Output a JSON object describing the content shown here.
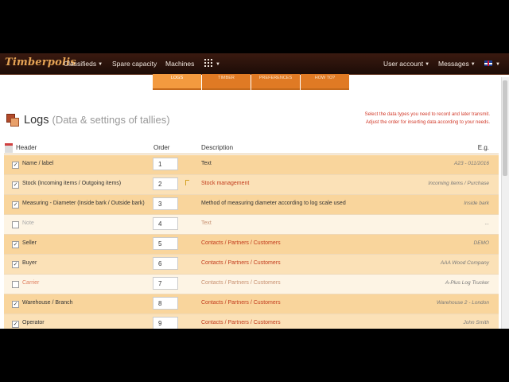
{
  "navbar": {
    "brand": "Timberpolis",
    "items": [
      {
        "label": "Classifieds",
        "caret": "▼"
      },
      {
        "label": "Spare capacity",
        "caret": ""
      },
      {
        "label": "Machines",
        "caret": ""
      }
    ],
    "apps_caret": "▼",
    "user_account": "User account",
    "messages": "Messages",
    "caret": "▼"
  },
  "tabs": [
    {
      "label": "LOGS",
      "active": true
    },
    {
      "label": "TIMBER",
      "active": false
    },
    {
      "label": "PREFERENCES",
      "active": false
    },
    {
      "label": "HOW TO?",
      "active": false
    }
  ],
  "page": {
    "title": "Logs",
    "subtitle": "(Data & settings of tallies)",
    "hint_line1": "Select the data types you need to record and later transmit.",
    "hint_line2": "Adjust the order for inserting data according to your needs."
  },
  "table": {
    "headers": {
      "header": "Header",
      "order": "Order",
      "description": "Description",
      "example": "E.g."
    },
    "rows": [
      {
        "checked": true,
        "label": "Name / label",
        "order": "1",
        "description": "Text",
        "desc_link": false,
        "example": "A23 - 011/2016"
      },
      {
        "checked": true,
        "label": "Stock (Incoming items / Outgoing items)",
        "order": "2",
        "description": "Stock management",
        "desc_link": true,
        "example": "Incoming items / Purchase"
      },
      {
        "checked": true,
        "label": "Measuring - Diameter (Inside bark / Outside bark)",
        "order": "3",
        "description": "Method of measuring diameter according to log scale used",
        "desc_link": false,
        "example": "Inside bark"
      },
      {
        "checked": false,
        "label": "Note",
        "order": "4",
        "description": "Text",
        "desc_link": false,
        "example": "..."
      },
      {
        "checked": true,
        "label": "Seller",
        "order": "5",
        "description": "Contacts / Partners / Customers",
        "desc_link": true,
        "example": "DEMO"
      },
      {
        "checked": true,
        "label": "Buyer",
        "order": "6",
        "description": "Contacts / Partners / Customers",
        "desc_link": true,
        "example": "AAA Wood Company"
      },
      {
        "checked": false,
        "label": "Carrier",
        "order": "7",
        "description": "Contacts / Partners / Customers",
        "desc_link": true,
        "example": "A-Plus Log Trucker"
      },
      {
        "checked": true,
        "label": "Warehouse / Branch",
        "order": "8",
        "description": "Contacts / Partners / Customers",
        "desc_link": true,
        "example": "Warehouse 2 - London"
      },
      {
        "checked": true,
        "label": "Operator",
        "order": "9",
        "description": "Contacts / Partners / Customers",
        "desc_link": true,
        "example": "John Smith"
      }
    ]
  },
  "icons": [
    "apps-grid-icon",
    "uk-flag-icon",
    "logs-icon",
    "table-header-icon",
    "checkbox-icon"
  ],
  "colors": {
    "brand": "#e6a455",
    "tab": "#e07a24",
    "row_highlight": "#fbe1b7",
    "link": "#c23b1c"
  }
}
